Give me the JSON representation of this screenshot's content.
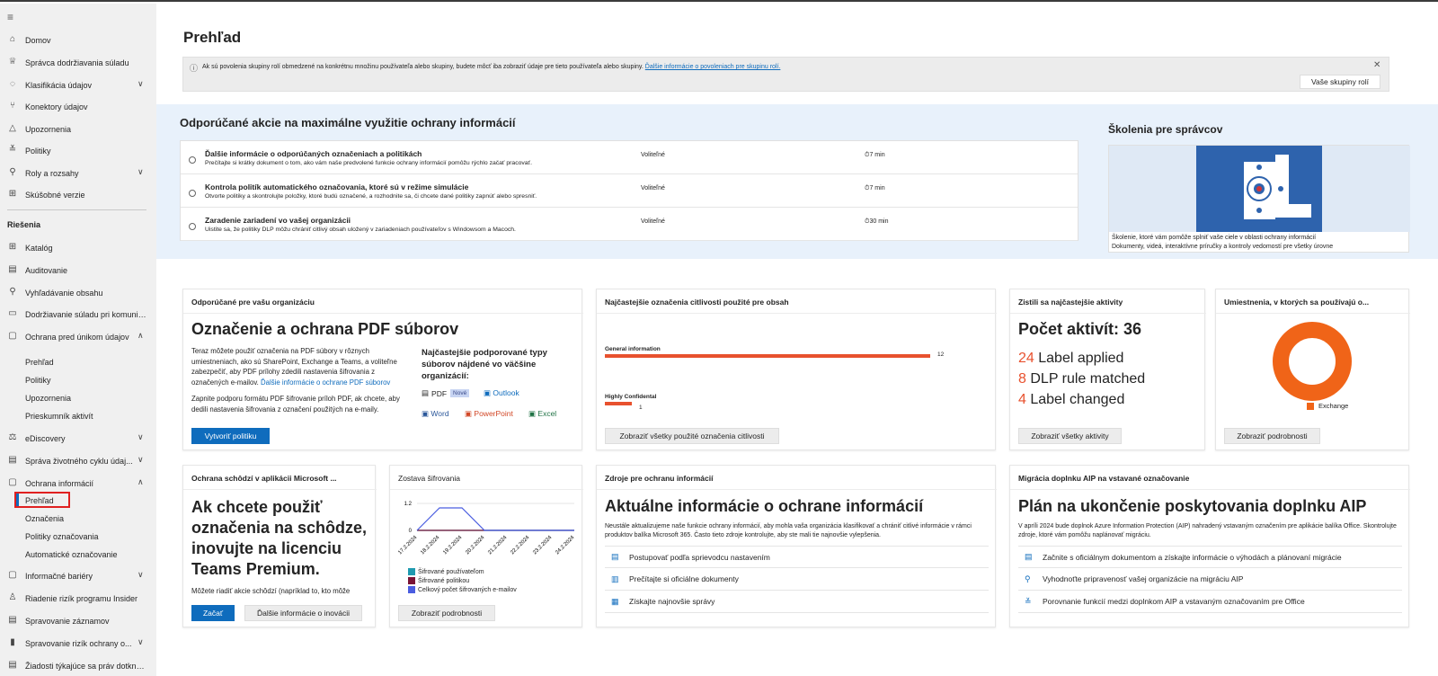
{
  "sidebar": {
    "items": [
      {
        "label": "Domov",
        "icon": "home-icon",
        "glyph": "⌂"
      },
      {
        "label": "Správca dodržiavania súladu",
        "icon": "trophy-icon",
        "glyph": "♕"
      },
      {
        "label": "Klasifikácia údajov",
        "icon": "classification-icon",
        "glyph": "◌",
        "chev": "∨"
      },
      {
        "label": "Konektory údajov",
        "icon": "connector-icon",
        "glyph": "⑂"
      },
      {
        "label": "Upozornenia",
        "icon": "alert-icon",
        "glyph": "△"
      },
      {
        "label": "Politiky",
        "icon": "policy-icon",
        "glyph": "≚"
      },
      {
        "label": "Roly a rozsahy",
        "icon": "roles-icon",
        "glyph": "⚲",
        "chev": "∨"
      },
      {
        "label": "Skúšobné verzie",
        "icon": "trial-icon",
        "glyph": "⊞"
      }
    ],
    "section_heading": "Riešenia",
    "solutions": [
      {
        "label": "Katalóg",
        "icon": "catalog-icon",
        "glyph": "⊞"
      },
      {
        "label": "Auditovanie",
        "icon": "audit-icon",
        "glyph": "▤"
      },
      {
        "label": "Vyhľadávanie obsahu",
        "icon": "search-icon",
        "glyph": "⚲"
      },
      {
        "label": "Dodržiavanie súladu pri komunik...",
        "icon": "communication-icon",
        "glyph": "▭"
      },
      {
        "label": "Ochrana pred únikom údajov",
        "icon": "dlp-icon",
        "glyph": "▢",
        "chev": "∧"
      }
    ],
    "dlp_sub": [
      "Prehľad",
      "Politiky",
      "Upozornenia",
      "Prieskumník aktivít"
    ],
    "solutions2": [
      {
        "label": "eDiscovery",
        "icon": "ediscovery-icon",
        "glyph": "⚖",
        "chev": "∨"
      },
      {
        "label": "Správa životného cyklu údaj...",
        "icon": "lifecycle-icon",
        "glyph": "▤",
        "chev": "∨"
      },
      {
        "label": "Ochrana informácií",
        "icon": "info-protection-icon",
        "glyph": "▢",
        "chev": "∧"
      }
    ],
    "ip_sub": [
      "Prehľad",
      "Označenia",
      "Politiky označovania",
      "Automatické označovanie"
    ],
    "solutions3": [
      {
        "label": "Informačné bariéry",
        "icon": "barrier-icon",
        "glyph": "▢",
        "chev": "∨"
      },
      {
        "label": "Riadenie rizík programu Insider",
        "icon": "insider-icon",
        "glyph": "♙"
      },
      {
        "label": "Spravovanie záznamov",
        "icon": "records-icon",
        "glyph": "▤"
      },
      {
        "label": "Spravovanie rizík ochrany o...",
        "icon": "privacy-risk-icon",
        "glyph": "▮",
        "chev": "∨"
      },
      {
        "label": "Žiadosti týkajúce sa práv dotknut...",
        "icon": "requests-icon",
        "glyph": "▤"
      }
    ]
  },
  "page": {
    "title": "Prehľad"
  },
  "banner": {
    "text": "Ak sú povolenia skupiny rolí obmedzené na konkrétnu množinu používateľa alebo skupiny, budete môcť iba zobraziť údaje pre tieto používateľa alebo skupiny.",
    "link": "Ďalšie informácie o povoleniach pre skupinu rolí.",
    "button": "Vaše skupiny rolí"
  },
  "recommended": {
    "title": "Odporúčané akcie na maximálne využitie ochrany informácií",
    "rows": [
      {
        "title": "Ďalšie informácie o odporúčaných označeniach a politikách",
        "desc": "Prečítajte si krátky dokument o tom, ako vám naše predvolené funkcie ochrany informácií pomôžu rýchlo začať pracovať.",
        "status": "Voliteľné",
        "time": "7 min"
      },
      {
        "title": "Kontrola politík automatického označovania, ktoré sú v režime simulácie",
        "desc": "Otvorte politiky a skontrolujte položky, ktoré budú označené, a rozhodnite sa, či chcete dané politiky zapnúť alebo spresniť.",
        "status": "Voliteľné",
        "time": "7 min"
      },
      {
        "title": "Zaradenie zariadení vo vašej organizácii",
        "desc": "Uistite sa, že politiky DLP môžu chrániť citlivý obsah uložený v zariadeniach používateľov s Windowsom a Macoch.",
        "status": "Voliteľné",
        "time": "30 min"
      }
    ]
  },
  "training": {
    "title": "Školenia pre správcov",
    "line1": "Školenie, ktoré vám pomôže splniť vaše ciele v oblasti ochrany informácií",
    "line2": "Dokumenty, videá, interaktívne príručky a kontroly vedomostí pre všetky úrovne"
  },
  "pdf_card": {
    "header": "Odporúčané pre vašu organizáciu",
    "title": "Označenie a ochrana PDF súborov",
    "p1": "Teraz môžete použiť označenia na PDF súbory v rôznych umiestneniach, ako sú SharePoint, Exchange a Teams, a voliteľne zabezpečiť, aby PDF prílohy zdedili nastavenia šifrovania z označených e-mailov.",
    "p1_link": "Ďalšie informácie o ochrane PDF súborov",
    "p2": "Zapnite podporu formátu PDF šifrovanie príloh PDF, ak chcete, aby dedili nastavenia šifrovania z označení použitých na e-maily.",
    "types_title": "Najčastejšie podporované typy súborov nájdené vo väčšine organizácií:",
    "types": [
      {
        "label": "PDF",
        "badge": "Nové",
        "color": "#444444"
      },
      {
        "label": "Outlook",
        "color": "#0f6cbd"
      },
      {
        "label": "Word",
        "color": "#2b579a"
      },
      {
        "label": "PowerPoint",
        "color": "#d24726"
      },
      {
        "label": "Excel",
        "color": "#217346"
      }
    ],
    "button": "Vytvoriť politiku"
  },
  "labels_card": {
    "header": "Najčastejšie označenia citlivosti použité pre obsah",
    "button": "Zobraziť všetky použité označenia citlivosti"
  },
  "chart_labels": {
    "type": "bar",
    "categories": [
      "General information",
      "Highly Confidental"
    ],
    "values": [
      12,
      1
    ],
    "color": "#e8512e"
  },
  "activities_card": {
    "header": "Zistili sa najčastejšie aktivity",
    "title": "Počet aktivít: 36",
    "items": [
      {
        "count": "24",
        "label": "Label applied"
      },
      {
        "count": "8",
        "label": "DLP rule matched"
      },
      {
        "count": "4",
        "label": "Label changed"
      }
    ],
    "button": "Zobraziť všetky aktivity"
  },
  "locations_card": {
    "header": "Umiestnenia, v ktorých sa používajú o...",
    "legend": "Exchange",
    "button": "Zobraziť podrobnosti",
    "color": "#f06418"
  },
  "meetings_card": {
    "header": "Ochrana schôdzí v aplikácii Microsoft ...",
    "title": "Ak chcete použiť označenia na schôdze, inovujte na licenciu Teams Premium.",
    "text": "Môžete riadiť akcie schôdzí (napríklad to, kto môže",
    "btn_start": "Začať",
    "btn_more": "Ďalšie informácie o inovácii"
  },
  "encryption_card": {
    "header": "Zostava šifrovania",
    "legend": [
      "Šifrované používateľom",
      "Šifrované politikou",
      "Celkový počet šifrovaných e-mailov"
    ],
    "legend_colors": [
      "#1f9ab0",
      "#7a1436",
      "#4a5de0"
    ],
    "button": "Zobraziť podrobnosti"
  },
  "chart_encryption": {
    "type": "line",
    "x": [
      "17.2.2024",
      "18.2.2024",
      "19.2.2024",
      "20.2.2024",
      "21.2.2024",
      "22.2.2024",
      "23.2.2024",
      "24.2.2024"
    ],
    "ylim": [
      0,
      1.2
    ],
    "yticks": [
      "1.2",
      "0"
    ],
    "series": [
      {
        "name": "Šifrované používateľom",
        "values": [
          0,
          0,
          0,
          0,
          0,
          0,
          0,
          0
        ]
      },
      {
        "name": "Šifrované politikou",
        "values": [
          0,
          0,
          0,
          0,
          0,
          0,
          0,
          0
        ]
      },
      {
        "name": "Celkový počet šifrovaných e-mailov",
        "values": [
          0,
          1,
          1,
          0,
          0,
          0,
          0,
          0
        ]
      }
    ]
  },
  "resources_card": {
    "header": "Zdroje pre ochranu informácií",
    "title": "Aktuálne informácie o ochrane informácií",
    "text": "Neustále aktualizujeme naše funkcie ochrany informácií, aby mohla vaša organizácia klasifikovať a chrániť citlivé informácie v rámci produktov balíka Microsoft 365. Často tieto zdroje kontrolujte, aby ste mali tie najnovšie vylepšenia.",
    "items": [
      {
        "label": "Postupovať podľa sprievodcu nastavením",
        "icon": "checklist-icon",
        "glyph": "▤"
      },
      {
        "label": "Prečítajte si oficiálne dokumenty",
        "icon": "book-icon",
        "glyph": "▥"
      },
      {
        "label": "Získajte najnovšie správy",
        "icon": "news-icon",
        "glyph": "▦"
      }
    ]
  },
  "aip_card": {
    "header": "Migrácia doplnku AIP na vstavané označovanie",
    "title": "Plán na ukončenie poskytovania doplnku AIP",
    "text": "V apríli 2024 bude doplnok Azure Information Protection (AIP) nahradený vstavaným označením pre aplikácie balíka Office. Skontrolujte zdroje, ktoré vám pomôžu naplánovať migráciu.",
    "items": [
      {
        "label": "Začnite s oficiálnym dokumentom a získajte informácie o výhodách a plánovaní migrácie",
        "icon": "document-icon",
        "glyph": "▤"
      },
      {
        "label": "Vyhodnoťte pripravenosť vašej organizácie na migráciu AIP",
        "icon": "search-icon",
        "glyph": "⚲"
      },
      {
        "label": "Porovnanie funkcií medzi doplnkom AIP a vstavaným označovaním pre Office",
        "icon": "compare-icon",
        "glyph": "≚"
      }
    ]
  }
}
